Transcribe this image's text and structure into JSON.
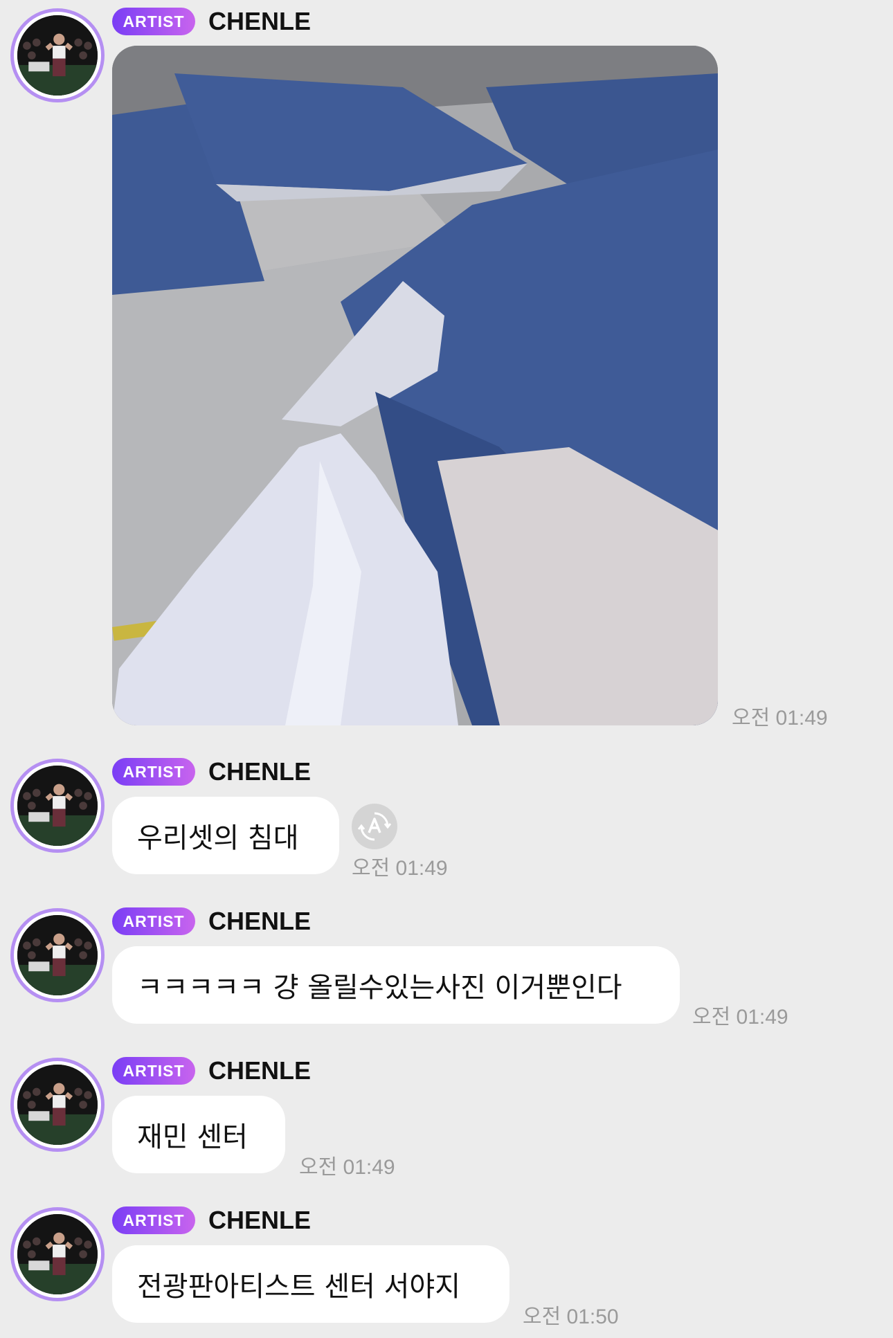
{
  "messages": [
    {
      "badge": "ARTIST",
      "sender": "CHENLE",
      "type": "image",
      "image_alt": "bed-photo",
      "time": "오전 01:49"
    },
    {
      "badge": "ARTIST",
      "sender": "CHENLE",
      "type": "text",
      "text": "우리셋의 침대",
      "time": "오전 01:49",
      "translate_icon": "translate-icon"
    },
    {
      "badge": "ARTIST",
      "sender": "CHENLE",
      "type": "text",
      "text": "ㅋㅋㅋㅋㅋ 걍 올릴수있는사진 이거뿐인다",
      "time": "오전 01:49"
    },
    {
      "badge": "ARTIST",
      "sender": "CHENLE",
      "type": "text",
      "text": "재민 센터",
      "time": "오전 01:49"
    },
    {
      "badge": "ARTIST",
      "sender": "CHENLE",
      "type": "text",
      "text": "전광판아티스트 센터 서야지",
      "time": "오전 01:50"
    }
  ],
  "colors": {
    "background": "#ececec",
    "bubble": "#ffffff",
    "badge_start": "#7a3ef5",
    "badge_end": "#c864ee",
    "avatar_ring": "#b58ff2",
    "time": "#9a9a9a"
  }
}
